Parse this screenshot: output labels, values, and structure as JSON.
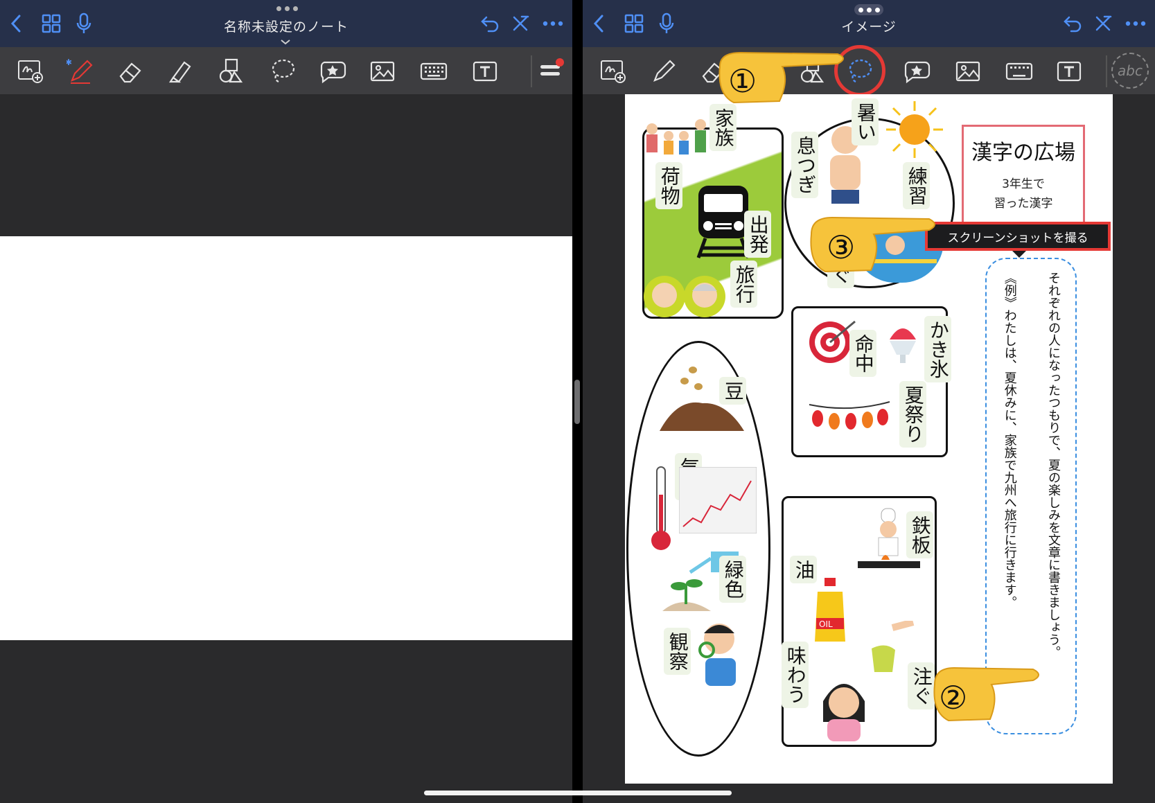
{
  "left": {
    "title": "名称未設定のノート"
  },
  "right": {
    "title": "イメージ",
    "tooltip": "スクリーンショットを撮る",
    "abc_label": "abc"
  },
  "worksheet": {
    "title": "漢字の広場",
    "subtitle_line1": "3年生で",
    "subtitle_line2": "習った漢字",
    "instruction": "それぞれの人になったつもりで、夏の楽しみを文章に書きましょう。",
    "example": "《例》わたしは、夏休みに、家族で九州へ旅行に行きます。",
    "words": {
      "kazoku": "家族",
      "nimotsu": "荷物",
      "shuppatsu": "出発",
      "ryokou": "旅行",
      "atsui": "暑い",
      "ikitsugi": "息つぎ",
      "renshuu": "練習",
      "oyogu_tail": "ぐ",
      "mame": "豆",
      "kion": "気温",
      "ryokushoku": "緑色",
      "kansatsu": "観察",
      "meichuu": "命中",
      "kakigoori": "かき氷",
      "natsumatsuri": "夏祭り",
      "teppan": "鉄板",
      "abura": "油",
      "ajiwau": "味わう",
      "sosogu": "注ぐ"
    }
  },
  "annotations": {
    "step1": "①",
    "step2": "②",
    "step3": "③"
  },
  "colors": {
    "accent": "#4f8ff5",
    "navbar": "#26304a",
    "toolbar": "#3d3d40",
    "highlight_red": "#e53935"
  }
}
